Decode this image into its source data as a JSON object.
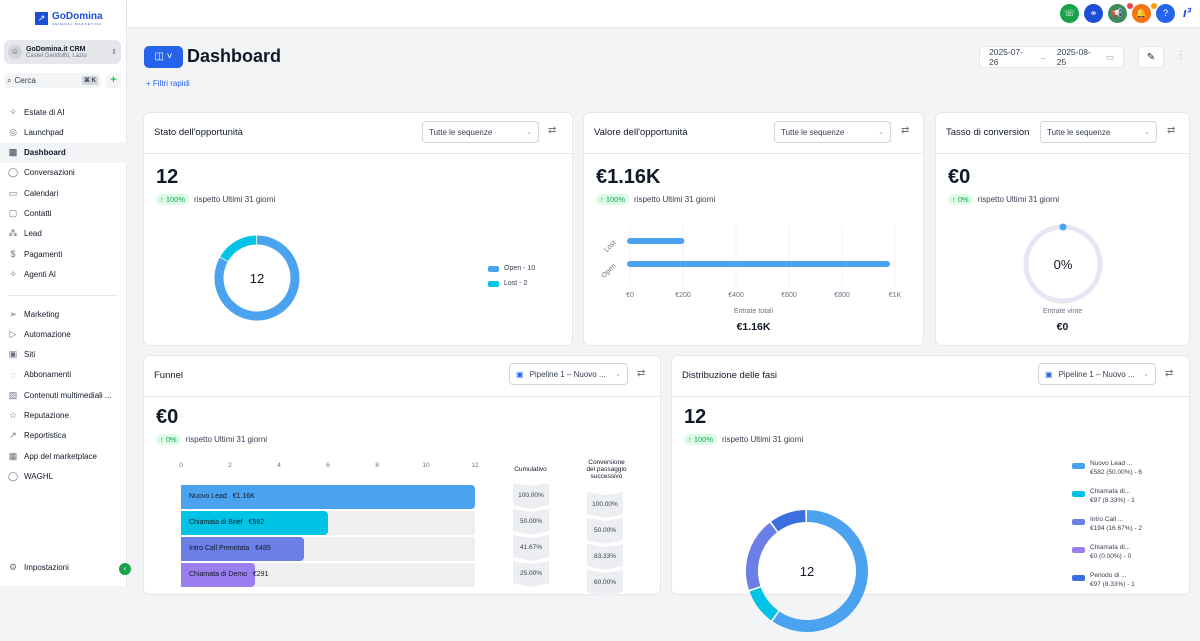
{
  "sidebar": {
    "brand": "GoDomina",
    "brand_sub": "GENERAL MARKETING",
    "account_name": "GoDomina.it CRM",
    "account_location": "Castel Gandolfo, Lazio",
    "search_placeholder": "Cerca",
    "search_shortcut": "⌘ K",
    "items": [
      {
        "label": "Estate di AI",
        "icon": "✧"
      },
      {
        "label": "Launchpad",
        "icon": "◎"
      },
      {
        "label": "Dashboard",
        "icon": "▦"
      },
      {
        "label": "Conversazioni",
        "icon": "◯"
      },
      {
        "label": "Calendari",
        "icon": "▭"
      },
      {
        "label": "Contatti",
        "icon": "▢"
      },
      {
        "label": "Lead",
        "icon": "⁂"
      },
      {
        "label": "Pagamenti",
        "icon": "$"
      },
      {
        "label": "Agenti AI",
        "icon": "✧"
      }
    ],
    "items2": [
      {
        "label": "Marketing",
        "icon": "➢"
      },
      {
        "label": "Automazione",
        "icon": "▷"
      },
      {
        "label": "Siti",
        "icon": "▣"
      },
      {
        "label": "Abbonamenti",
        "icon": "◌"
      },
      {
        "label": "Contenuti multimediali ...",
        "icon": "▨"
      },
      {
        "label": "Reputazione",
        "icon": "☆"
      },
      {
        "label": "Reportistica",
        "icon": "↗"
      },
      {
        "label": "App del marketplace",
        "icon": "▦"
      },
      {
        "label": "WAGHL",
        "icon": "◯"
      }
    ],
    "settings": "Impostazioni"
  },
  "topbar": {
    "icons": [
      "phone-icon",
      "link-icon",
      "megaphone-icon",
      "bell-icon",
      "help-icon"
    ],
    "colors": [
      "#16a34a",
      "#1d4ed8",
      "#3f8a5e",
      "#f97316",
      "#2563eb"
    ],
    "help": "?"
  },
  "header": {
    "title": "Dashboard",
    "quick_filters": "+ Filtri rapidi",
    "date_from": "2025-07-26",
    "date_to": "2025-08-25"
  },
  "cards": {
    "stato": {
      "title": "Stato dell'opportunità",
      "select": "Tutte le sequenze",
      "value": "12",
      "delta": "↑ 100%",
      "compare": "rispetto Ultimi 31 giorni",
      "center": "12",
      "legend": [
        {
          "label": "Open - 10",
          "value": 10,
          "color": "#4ba3f0"
        },
        {
          "label": "Lost - 2",
          "value": 2,
          "color": "#00c4e6"
        }
      ]
    },
    "valore": {
      "title": "Valore dell'opportunità",
      "select": "Tutte le sequenze",
      "value": "€1.16K",
      "delta": "↑ 100%",
      "compare": "rispetto Ultimi 31 giorni",
      "footer_label": "Entrate totali",
      "footer_value": "€1.16K"
    },
    "tasso": {
      "title": "Tasso di conversion",
      "select": "Tutte le sequenze",
      "value": "€0",
      "delta": "↑ 0%",
      "compare": "rispetto Ultimi 31 giorni",
      "center": "0%",
      "footer_label": "Entrate vinte",
      "footer_value": "€0"
    },
    "funnel": {
      "title": "Funnel",
      "select": "Pipeline 1 – Nuovo ...",
      "value": "€0",
      "delta": "↑ 0%",
      "compare": "rispetto Ultimi 31 giorni",
      "col_cumulative": "Cumulativo",
      "col_next": "Conversione del passaggio successivo"
    },
    "distribuzione": {
      "title": "Distribuzione delle fasi",
      "select": "Pipeline 1 – Nuovo ...",
      "value": "12",
      "delta": "↑ 100%",
      "compare": "rispetto Ultimi 31 giorni",
      "center": "12"
    }
  },
  "chart_data": [
    {
      "type": "bar",
      "title": "Valore dell'opportunità",
      "categories": [
        "Lost",
        "Open"
      ],
      "values": [
        194,
        970
      ],
      "xticks": [
        "€0",
        "€200",
        "€400",
        "€600",
        "€800",
        "€1K"
      ],
      "xlim": [
        0,
        1000
      ],
      "color": "#4ba3f0"
    },
    {
      "type": "bar",
      "title": "Funnel",
      "xticks": [
        "0",
        "2",
        "4",
        "6",
        "8",
        "10",
        "12"
      ],
      "xlim": [
        0,
        12
      ],
      "rows": [
        {
          "label": "Nuovo Lead",
          "amount": "€1.16K",
          "count": 12,
          "color": "#4ba3f0",
          "cumulative": "100.00%",
          "next": "100.00%"
        },
        {
          "label": "Chiamata di Brief",
          "amount": "€582",
          "count": 6,
          "color": "#00c4e6",
          "cumulative": "50.00%",
          "next": "50.00%"
        },
        {
          "label": "Intro Call Prenotata",
          "amount": "€485",
          "count": 5,
          "color": "#6b7fe6",
          "cumulative": "41.67%",
          "next": "83.33%"
        },
        {
          "label": "Chiamata di Demo",
          "amount": "€291",
          "count": 3,
          "color": "#9b7ff0",
          "cumulative": "25.00%",
          "next": "60.00%"
        }
      ]
    },
    {
      "type": "pie",
      "title": "Distribuzione delle fasi",
      "slices": [
        {
          "name": "Nuovo Lead ...",
          "detail": "€582 (50.00%) - 6",
          "value": 6,
          "color": "#4ba3f0"
        },
        {
          "name": "Chiamata di...",
          "detail": "€97 (8.33%) - 1",
          "value": 1,
          "color": "#00c4e6"
        },
        {
          "name": "Intro Call ...",
          "detail": "€194 (16.67%) - 2",
          "value": 2,
          "color": "#6b7fe6"
        },
        {
          "name": "Chiamata di...",
          "detail": "€0 (0.00%) - 0",
          "value": 0,
          "color": "#9b7ff0"
        },
        {
          "name": "Periodo di ...",
          "detail": "€97 (8.33%) - 1",
          "value": 1,
          "color": "#3b6fe0"
        }
      ]
    }
  ]
}
